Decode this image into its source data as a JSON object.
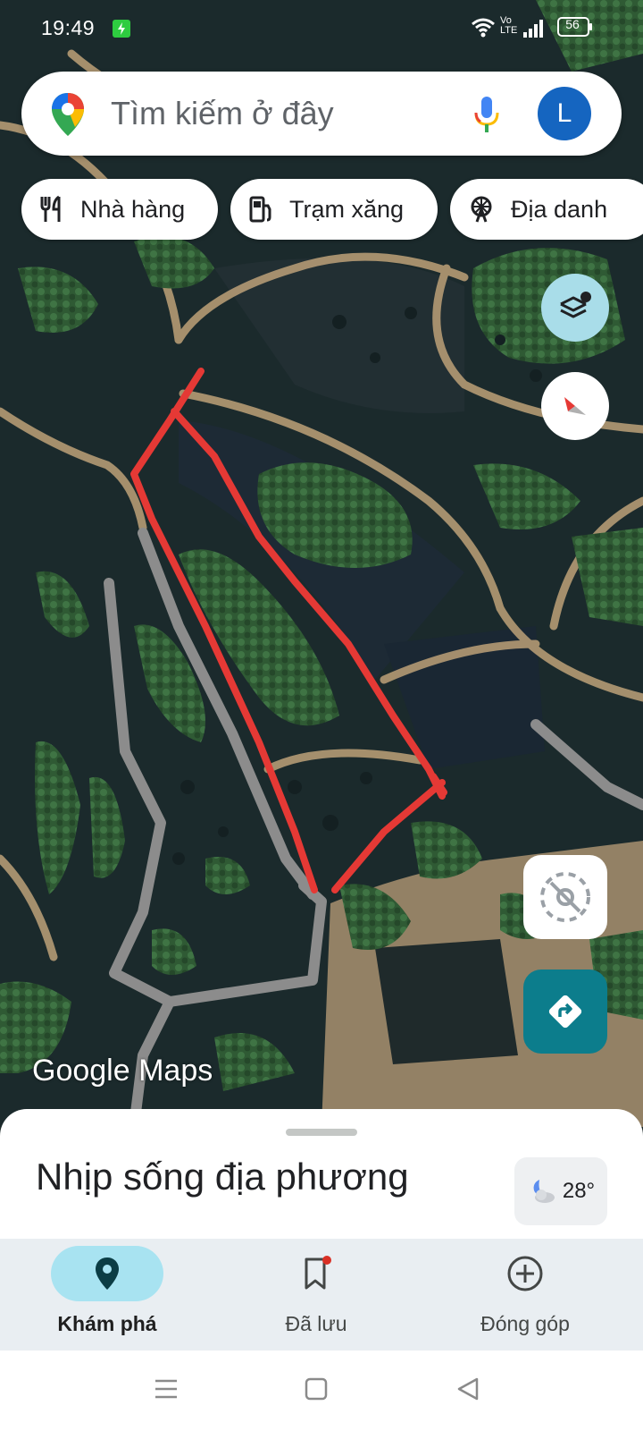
{
  "status_bar": {
    "time": "19:49",
    "battery": "56",
    "network_label": "Vo LTE",
    "icons": [
      "charging-icon",
      "wifi-icon",
      "volte-icon",
      "signal-icon",
      "battery-icon"
    ]
  },
  "search": {
    "placeholder": "Tìm kiếm ở đây",
    "avatar_letter": "L",
    "icons": [
      "google-maps-pin-icon",
      "microphone-icon"
    ]
  },
  "chips": [
    {
      "label": "Nhà hàng",
      "icon": "fork-knife-icon"
    },
    {
      "label": "Trạm xăng",
      "icon": "gas-pump-icon"
    },
    {
      "label": "Địa danh",
      "icon": "ferris-wheel-icon"
    }
  ],
  "map": {
    "view": "satellite",
    "watermark": "Google Maps",
    "user_drawn_outline_color": "#e53935",
    "road_color": "#8c8c8c",
    "buttons": [
      "layers-icon",
      "compass-icon",
      "location-off-icon",
      "directions-icon"
    ]
  },
  "bottom_sheet": {
    "title": "Nhịp sống địa phương",
    "weather": {
      "temperature": "28°",
      "icon": "moon-cloud-icon"
    }
  },
  "bottom_nav": {
    "items": [
      {
        "label": "Khám phá",
        "icon": "explore-pin-icon",
        "active": true
      },
      {
        "label": "Đã lưu",
        "icon": "bookmark-icon",
        "active": false
      },
      {
        "label": "Đóng góp",
        "icon": "add-circle-icon",
        "active": false
      }
    ]
  },
  "colors": {
    "accent": "#0c7d8c",
    "active_pill": "#a8e3f1",
    "avatar": "#1565c0",
    "layers_button": "#a9dde9"
  }
}
